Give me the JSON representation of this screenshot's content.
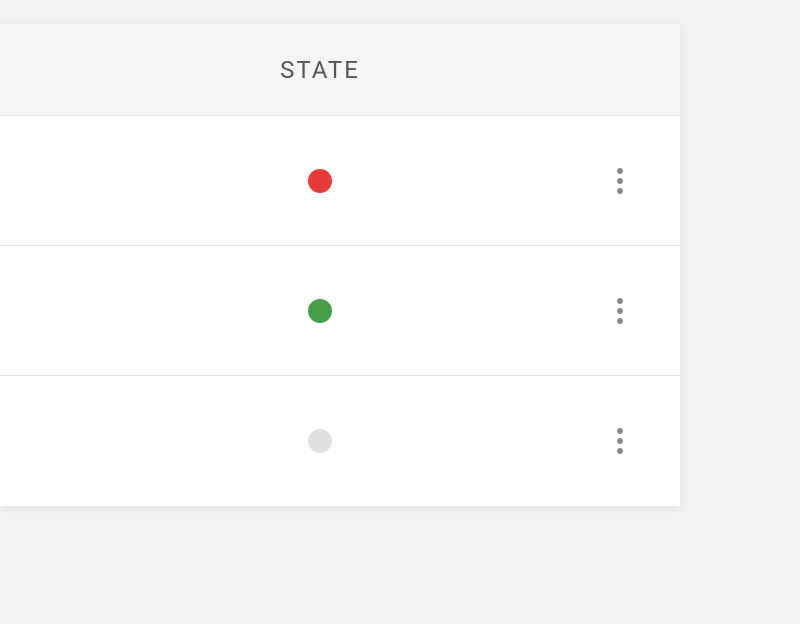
{
  "table": {
    "header": {
      "state_label": "STATE"
    },
    "rows": [
      {
        "state_color": "#e53935"
      },
      {
        "state_color": "#43a047"
      },
      {
        "state_color": "#e0e0e0"
      }
    ]
  }
}
